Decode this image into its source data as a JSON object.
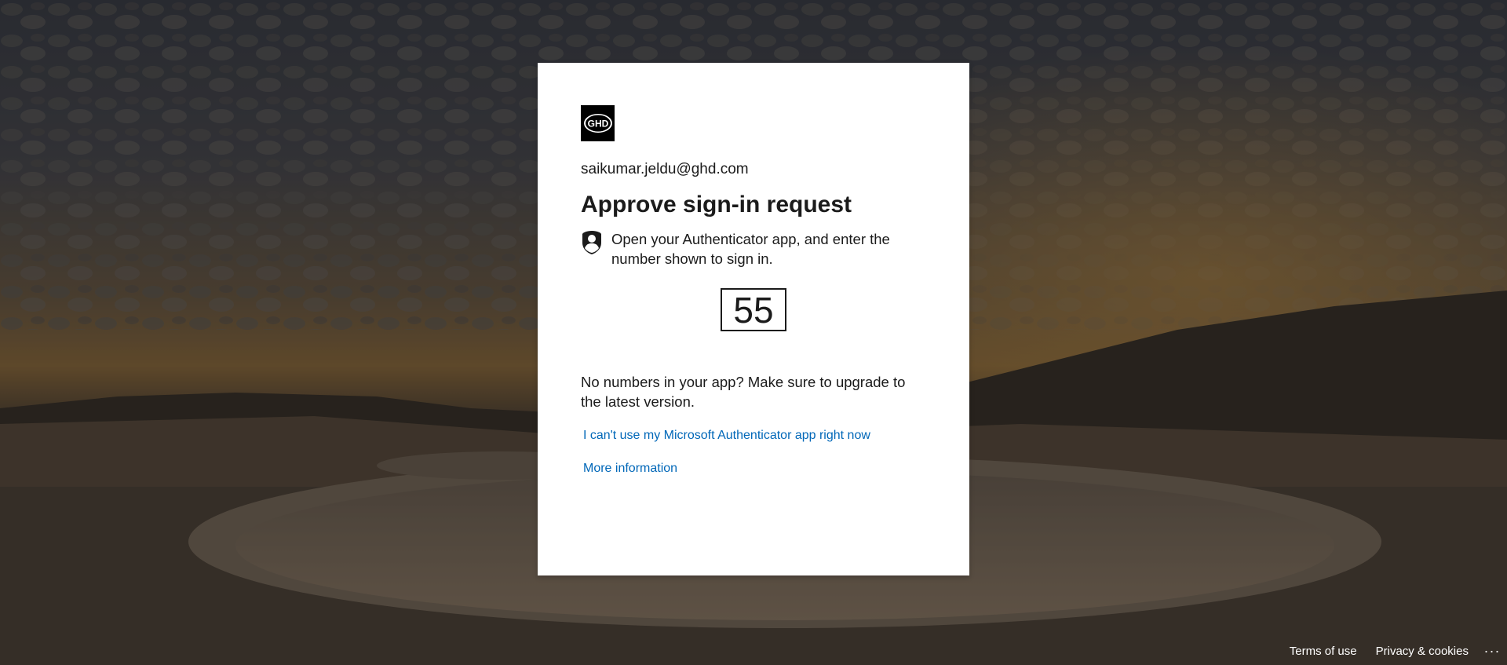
{
  "account": {
    "email": "saikumar.jeldu@ghd.com"
  },
  "logo": {
    "text": "GHD"
  },
  "dialog": {
    "title": "Approve sign-in request",
    "instruction": "Open your Authenticator app, and enter the number shown to sign in.",
    "number": "55",
    "note": "No numbers in your app? Make sure to upgrade to the latest version.",
    "cant_use_link": "I can't use my Microsoft Authenticator app right now",
    "more_info_link": "More information"
  },
  "footer": {
    "terms": "Terms of use",
    "privacy": "Privacy & cookies",
    "more": "..."
  },
  "colors": {
    "link": "#0067b8",
    "text": "#1b1b1b",
    "card": "#ffffff"
  },
  "icons": {
    "authenticator": "authenticator-icon",
    "logo": "ghd-logo"
  }
}
